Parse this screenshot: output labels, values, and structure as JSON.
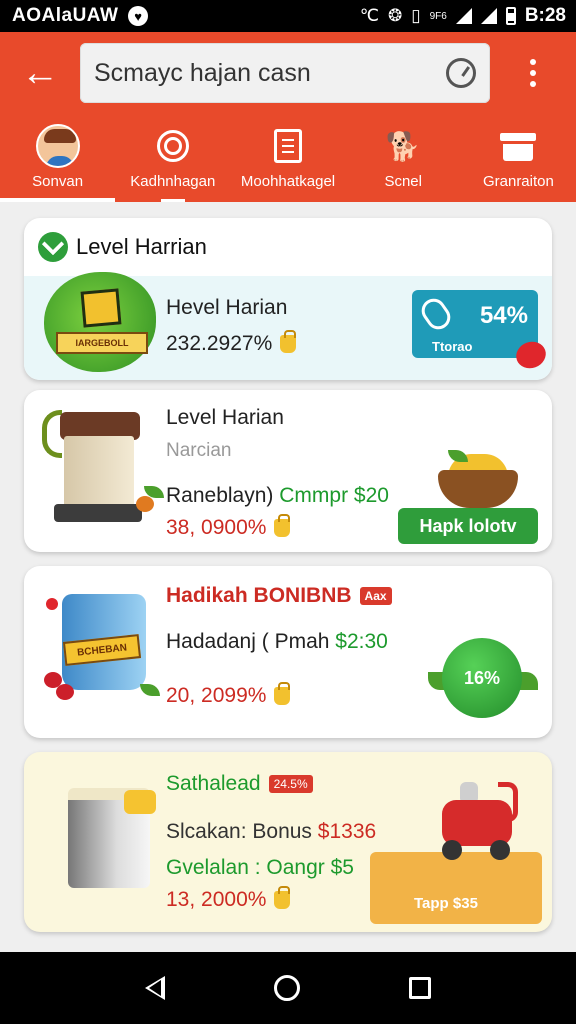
{
  "status": {
    "carrier": "AOAlaUAW",
    "icons_left": [
      "heart-icon"
    ],
    "icons_right": [
      "alarm-icon",
      "settings-icon",
      "vibrate-icon",
      "signal-icon",
      "wifi-icon",
      "battery-icon"
    ],
    "network_small": "9F6",
    "time": "B:28"
  },
  "appbar": {
    "search_text": "Scmayc hajan casn",
    "icons": [
      "back-arrow-icon",
      "clock-icon",
      "more-vert-icon"
    ]
  },
  "tabs": [
    {
      "label": "Sonvan",
      "icon": "avatar-icon",
      "active": true
    },
    {
      "label": "Kadhnhagan",
      "icon": "target-icon",
      "active": false
    },
    {
      "label": "Moohhatkagel",
      "icon": "document-icon",
      "active": false
    },
    {
      "label": "Scnel",
      "icon": "dog-icon",
      "active": false
    },
    {
      "label": "Granraiton",
      "icon": "tray-icon",
      "active": false
    }
  ],
  "cards": [
    {
      "header": "Level Harrian",
      "title": "Hevel Harian",
      "value": "232.2927%",
      "art_label": "IARGEBOLL",
      "pct": "54%",
      "pct_label": "Ttorao"
    },
    {
      "title": "Level Harian",
      "subtitle": "Narcian",
      "mid_prefix": "Raneblayn)",
      "mid_green": "Cmmpr $20",
      "value": "38, 0900%",
      "button": "Hapk lolotv"
    },
    {
      "title": "Hadikah BONIBNB",
      "tag": "Aax",
      "mid_prefix": "Hadadanj ( Pmah",
      "mid_green": "$2:30",
      "value": "20, 2099%",
      "art_label": "BCHEBAN",
      "badge": "16%"
    },
    {
      "title": "Sathalead",
      "tag": "24.5%",
      "line2_prefix": "Slcakan: Bonus",
      "line2_red": "$1336",
      "line3": "Gvelalan : Oangr $5",
      "value": "13, 2000%",
      "button": "Tapp $35"
    }
  ],
  "navbar": {
    "icons": [
      "nav-back-icon",
      "nav-home-icon",
      "nav-recents-icon"
    ]
  }
}
